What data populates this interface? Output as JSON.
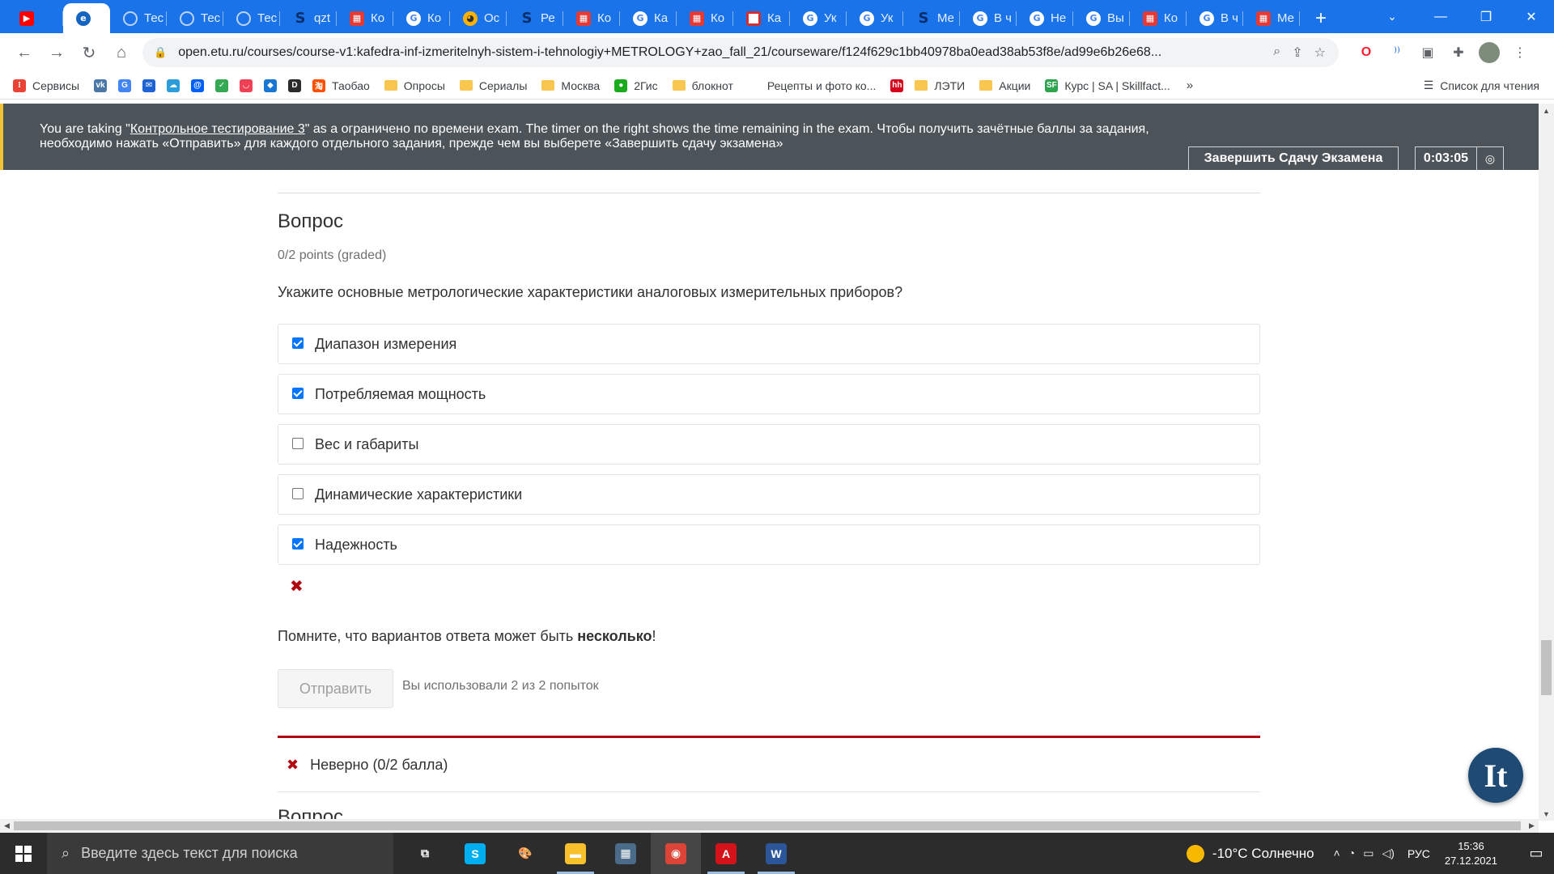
{
  "browser": {
    "tabs": [
      {
        "label": "",
        "icon": "youtube-icon",
        "favclass": "fav-youtube",
        "glyph": "▶"
      },
      {
        "label": "",
        "icon": "edge-icon",
        "favclass": "fav-edge",
        "glyph": "e",
        "active": true
      },
      {
        "label": "Тес",
        "icon": "loading-icon",
        "favclass": "fav-blank",
        "glyph": ""
      },
      {
        "label": "Тес",
        "icon": "loading-icon",
        "favclass": "fav-blank",
        "glyph": ""
      },
      {
        "label": "Тес",
        "icon": "loading-icon",
        "favclass": "fav-blank",
        "glyph": ""
      },
      {
        "label": "qzt",
        "icon": "s-icon",
        "favclass": "fav-s",
        "glyph": "S"
      },
      {
        "label": "Ко",
        "icon": "grid-red-icon",
        "favclass": "fav-red",
        "glyph": "▦"
      },
      {
        "label": "Ко",
        "icon": "google-icon",
        "favclass": "fav-google",
        "glyph": "G"
      },
      {
        "label": "Ос",
        "icon": "owl-icon",
        "favclass": "fav-owl",
        "glyph": "◕"
      },
      {
        "label": "Ре",
        "icon": "s-icon",
        "favclass": "fav-s",
        "glyph": "S"
      },
      {
        "label": "Ко",
        "icon": "grid-red-icon",
        "favclass": "fav-red",
        "glyph": "▦"
      },
      {
        "label": "Ка",
        "icon": "google-icon",
        "favclass": "fav-google",
        "glyph": "G"
      },
      {
        "label": "Ко",
        "icon": "grid-red-icon",
        "favclass": "fav-red",
        "glyph": "▦"
      },
      {
        "label": "Ка",
        "icon": "grid-icon",
        "favclass": "fav-grid",
        "glyph": ""
      },
      {
        "label": "Ук",
        "icon": "google-icon",
        "favclass": "fav-google",
        "glyph": "G"
      },
      {
        "label": "Ук",
        "icon": "google-icon",
        "favclass": "fav-google",
        "glyph": "G"
      },
      {
        "label": "Ме",
        "icon": "s-icon",
        "favclass": "fav-s",
        "glyph": "S"
      },
      {
        "label": "В ч",
        "icon": "google-icon",
        "favclass": "fav-google",
        "glyph": "G"
      },
      {
        "label": "Не",
        "icon": "google-icon",
        "favclass": "fav-google",
        "glyph": "G"
      },
      {
        "label": "Вы",
        "icon": "google-icon",
        "favclass": "fav-google",
        "glyph": "G"
      },
      {
        "label": "Ко",
        "icon": "grid-red-icon",
        "favclass": "fav-red",
        "glyph": "▦"
      },
      {
        "label": "В ч",
        "icon": "google-icon",
        "favclass": "fav-google",
        "glyph": "G"
      },
      {
        "label": "Ме",
        "icon": "grid-red-icon",
        "favclass": "fav-red",
        "glyph": "▦"
      }
    ],
    "url": "open.etu.ru/courses/course-v1:kafedra-inf-izmeritelnyh-sistem-i-tehnologiy+METROLOGY+zao_fall_21/courseware/f124f629c1bb40978ba0ead38ab53f8e/ad99e6b26e68...",
    "bookmarks": [
      {
        "label": "Сервисы",
        "icon": "apps-icon",
        "color": "#ea4335",
        "glyph": "⁝"
      },
      {
        "label": "",
        "icon": "vk-icon",
        "color": "#4a76a8",
        "glyph": "vk"
      },
      {
        "label": "",
        "icon": "translate-icon",
        "color": "#4285f4",
        "glyph": "G"
      },
      {
        "label": "",
        "icon": "mail-icon",
        "color": "#1e63d6",
        "glyph": "✉"
      },
      {
        "label": "",
        "icon": "cloud-icon",
        "color": "#2d9cdb",
        "glyph": "☁"
      },
      {
        "label": "",
        "icon": "mailru-icon",
        "color": "#005ff9",
        "glyph": "@"
      },
      {
        "label": "",
        "icon": "check-icon",
        "color": "#34a853",
        "glyph": "✓"
      },
      {
        "label": "",
        "icon": "pocket-icon",
        "color": "#ef4056",
        "glyph": "◡"
      },
      {
        "label": "",
        "icon": "drop-icon",
        "color": "#1976d2",
        "glyph": "◆"
      },
      {
        "label": "",
        "icon": "d-icon",
        "color": "#2b2b2b",
        "glyph": "D"
      },
      {
        "label": "Таобао",
        "icon": "taobao-icon",
        "color": "#ff5000",
        "glyph": "淘"
      },
      {
        "label": "Опросы",
        "icon": "folder-icon",
        "color": "",
        "glyph": ""
      },
      {
        "label": "Сериалы",
        "icon": "folder-icon",
        "color": "",
        "glyph": ""
      },
      {
        "label": "Москва",
        "icon": "folder-icon",
        "color": "",
        "glyph": ""
      },
      {
        "label": "2Гис",
        "icon": "2gis-icon",
        "color": "#19aa1e",
        "glyph": "●"
      },
      {
        "label": "блокнот",
        "icon": "folder-icon",
        "color": "",
        "glyph": ""
      },
      {
        "label": "Рецепты и фото ко...",
        "icon": "recipe-icon",
        "color": "#ffffff",
        "glyph": ""
      },
      {
        "label": "",
        "icon": "hh-icon",
        "color": "#d6001c",
        "glyph": "hh"
      },
      {
        "label": "ЛЭТИ",
        "icon": "folder-icon",
        "color": "",
        "glyph": ""
      },
      {
        "label": "Акции",
        "icon": "folder-icon",
        "color": "",
        "glyph": ""
      },
      {
        "label": "Курс | SA | Skillfact...",
        "icon": "skillfactory-icon",
        "color": "#2ea44f",
        "glyph": "SF"
      }
    ],
    "bookmarks_more": "»",
    "reading_list": "Список для чтения"
  },
  "exam": {
    "banner_prefix": "You are taking \"",
    "exam_name": "Контрольное тестирование 3",
    "banner_suffix": "\" as a ограничено по времени exam. The timer on the right shows the time remaining in the exam. Чтобы получить зачётные баллы за задания,",
    "banner_line2": "необходимо нажать «Отправить» для каждого отдельного задания, прежде чем вы выберете «Завершить сдачу экзамена»",
    "finish_button": "Завершить Сдачу Экзамена",
    "timer": "0:03:05"
  },
  "problem": {
    "title": "Вопрос",
    "points": "0/2 points (graded)",
    "question": "Укажите основные метрологические характеристики аналоговых измерительных приборов?",
    "choices": [
      {
        "label": "Диапазон измерения",
        "checked": true
      },
      {
        "label": "Потребляемая мощность",
        "checked": true
      },
      {
        "label": "Вес и габариты",
        "checked": false
      },
      {
        "label": "Динамические характеристики",
        "checked": false
      },
      {
        "label": "Надежность",
        "checked": true
      }
    ],
    "hint_prefix": "Помните, что вариантов ответа может быть ",
    "hint_bold": "несколько",
    "hint_suffix": "!",
    "submit_label": "Отправить",
    "attempts": "Вы использовали 2 из 2 попыток",
    "result": "Неверно (0/2 балла)",
    "next_title": "Вопрос"
  },
  "badge": "It",
  "taskbar": {
    "search_placeholder": "Введите здесь текст для поиска",
    "apps": [
      {
        "icon": "task-view-icon",
        "color": "transparent",
        "glyph": "⧉",
        "state": ""
      },
      {
        "icon": "skype-icon",
        "color": "#00aff0",
        "glyph": "S",
        "state": ""
      },
      {
        "icon": "paint-icon",
        "color": "transparent",
        "glyph": "🎨",
        "state": ""
      },
      {
        "icon": "explorer-icon",
        "color": "#f8c12c",
        "glyph": "▬",
        "state": "running"
      },
      {
        "icon": "calculator-icon",
        "color": "#4a6b8a",
        "glyph": "▦",
        "state": ""
      },
      {
        "icon": "chrome-icon",
        "color": "#db4437",
        "glyph": "◉",
        "state": "active"
      },
      {
        "icon": "acrobat-icon",
        "color": "#d4121a",
        "glyph": "A",
        "state": "running"
      },
      {
        "icon": "word-icon",
        "color": "#2b579a",
        "glyph": "W",
        "state": "running"
      }
    ],
    "weather": "-10°C  Солнечно",
    "lang": "РУС",
    "time": "15:36",
    "date": "27.12.2021"
  }
}
